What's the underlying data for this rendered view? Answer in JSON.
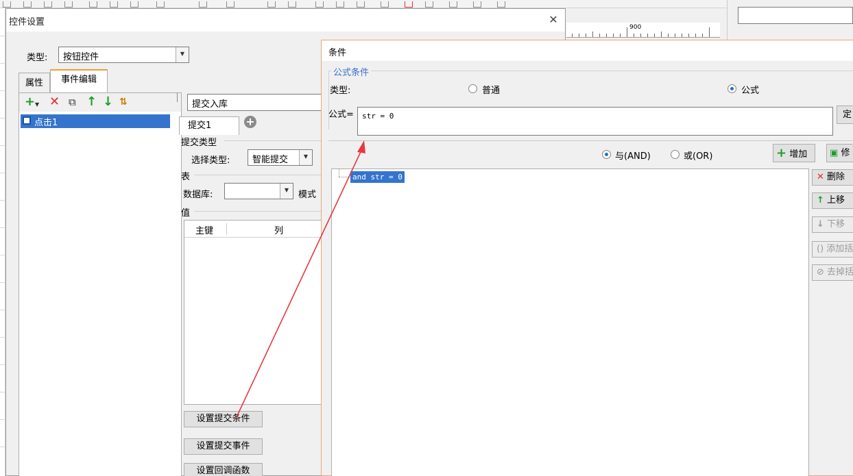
{
  "dialog1": {
    "title": "控件设置",
    "type_label": "类型:",
    "type_value": "按钮控件",
    "tabs": [
      {
        "label": "属性"
      },
      {
        "label": "事件编辑"
      }
    ],
    "event_items": [
      {
        "label": "点击1"
      }
    ],
    "submit_type_value": "提交入库",
    "submit_tab_label": "提交1",
    "group_submit_type": "提交类型",
    "select_type_label": "选择类型:",
    "select_type_value": "智能提交",
    "group_table": "表",
    "database_label": "数据库:",
    "database_value": "",
    "mode_label": "模式",
    "group_values": "值",
    "table_headers": [
      "主键",
      "列"
    ],
    "buttons": {
      "set_condition": "设置提交条件",
      "set_event": "设置提交事件",
      "set_callback": "设置回调函数"
    },
    "close_glyph": "✕"
  },
  "dialog2": {
    "title": "条件",
    "group_label": "公式条件",
    "type_label": "类型:",
    "radio_normal": "普通",
    "radio_formula": "公式",
    "formula_label": "公式=",
    "formula_value": "str = 0",
    "define_button": "定",
    "radio_and": "与(AND)",
    "radio_or": "或(OR)",
    "add_button": "增加",
    "modify_button": "修",
    "tree_node": "and str = 0",
    "side_buttons": {
      "delete": "删除",
      "up": "上移",
      "down": "下移",
      "add_paren": "添加括号",
      "remove_paren": "去掉括号"
    },
    "selected_type": "formula",
    "selected_logic": "AND"
  },
  "background": {
    "ruler_label": "900"
  },
  "colors": {
    "selection": "#3474cd",
    "group_label": "#3a6fd0",
    "annotation_arrow": "#e8383d",
    "delete_red": "#e02b2b",
    "arrow_green": "#1a9e2a"
  }
}
